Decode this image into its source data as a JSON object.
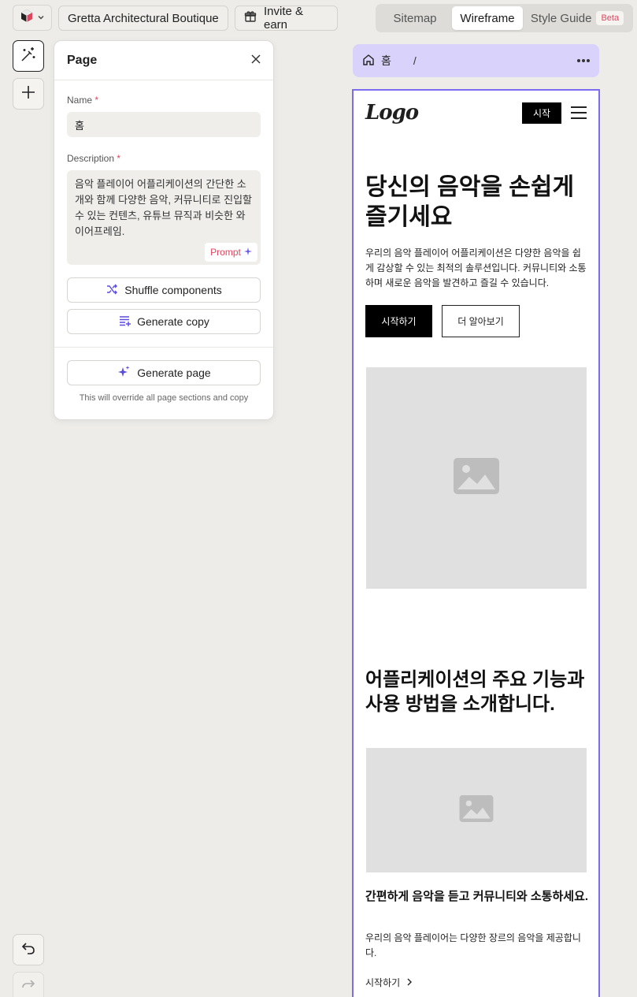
{
  "topbar": {
    "project_name": "Gretta Architectural Boutique",
    "invite_label": "Invite & earn",
    "tabs": [
      {
        "label": "Sitemap"
      },
      {
        "label": "Wireframe"
      },
      {
        "label": "Style Guide"
      }
    ],
    "beta_badge": "Beta",
    "active_tab": "Wireframe"
  },
  "panel": {
    "title": "Page",
    "name_label": "Name",
    "name_value": "홈",
    "description_label": "Description",
    "required_mark": "*",
    "description_value": "음악 플레이어 어플리케이션의 간단한 소개와 함께 다양한 음악, 커뮤니티로 진입할 수 있는 컨텐츠, 유튜브 뮤직과 비슷한 와이어프레임.",
    "prompt_label": "Prompt",
    "shuffle_label": "Shuffle components",
    "generate_copy_label": "Generate copy",
    "generate_page_label": "Generate page",
    "override_hint": "This will override all page sections and copy"
  },
  "breadcrumb": {
    "page_name": "홈",
    "path": "/"
  },
  "wireframe": {
    "logo_text": "Logo",
    "nav_button": "시작",
    "hero_title": "당신의 음악을 손쉽게 즐기세요",
    "hero_body": "우리의 음악 플레이어 어플리케이션은 다양한 음악을 쉽게 감상할 수 있는 최적의 솔루션입니다. 커뮤니티와 소통하며 새로운 음악을 발견하고 즐길 수 있습니다.",
    "primary_button": "시작하기",
    "secondary_button": "더 알아보기",
    "section_title": "어플리케이션의 주요 기능과 사용 방법을 소개합니다.",
    "feature_title": "간편하게 음악을 듣고 커뮤니티와 소통하세요.",
    "feature_body": "우리의 음악 플레이어는 다양한 장르의 음악을 제공합니다.",
    "feature_link": "시작하기"
  },
  "colors": {
    "accent": "#7b6cf0",
    "breadcrumb_bg": "#d9d3fb",
    "required": "#e0455e",
    "canvas_bg": "#edece9"
  }
}
